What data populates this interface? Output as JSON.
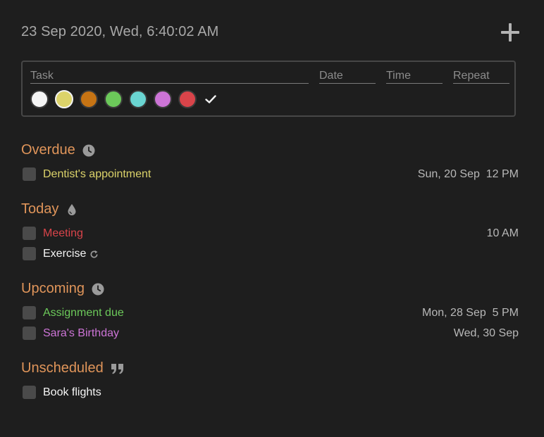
{
  "header": {
    "datetime": "23 Sep 2020, Wed, 6:40:02 AM"
  },
  "composer": {
    "task_placeholder": "Task",
    "date_placeholder": "Date",
    "time_placeholder": "Time",
    "repeat_placeholder": "Repeat",
    "colors": [
      {
        "name": "white",
        "hex": "#f5f5f5"
      },
      {
        "name": "yellow",
        "hex": "#dcd36a"
      },
      {
        "name": "orange",
        "hex": "#c77414"
      },
      {
        "name": "green",
        "hex": "#6cc95a"
      },
      {
        "name": "cyan",
        "hex": "#6ad5d2"
      },
      {
        "name": "violet",
        "hex": "#cc74d6"
      },
      {
        "name": "red",
        "hex": "#d9444a"
      }
    ],
    "selected_color": "yellow"
  },
  "sections": {
    "overdue": {
      "title": "Overdue",
      "icon": "clock-icon",
      "tasks": [
        {
          "label": "Dentist's appointment",
          "when": "Sun, 20 Sep  12 PM",
          "color": "#dcd36a"
        }
      ]
    },
    "today": {
      "title": "Today",
      "icon": "drop-icon",
      "tasks": [
        {
          "label": "Meeting",
          "when": "10 AM",
          "color": "#d9444a"
        },
        {
          "label": "Exercise",
          "when": "",
          "color": "#f5f5f5",
          "repeat": true
        }
      ]
    },
    "upcoming": {
      "title": "Upcoming",
      "icon": "clock-icon",
      "tasks": [
        {
          "label": "Assignment due",
          "when": "Mon, 28 Sep  5 PM",
          "color": "#6cc95a"
        },
        {
          "label": "Sara's Birthday",
          "when": "Wed, 30 Sep",
          "color": "#cc74d6"
        }
      ]
    },
    "unscheduled": {
      "title": "Unscheduled",
      "icon": "quote-icon",
      "tasks": [
        {
          "label": "Book flights",
          "when": "",
          "color": "#f5f5f5"
        }
      ]
    }
  }
}
